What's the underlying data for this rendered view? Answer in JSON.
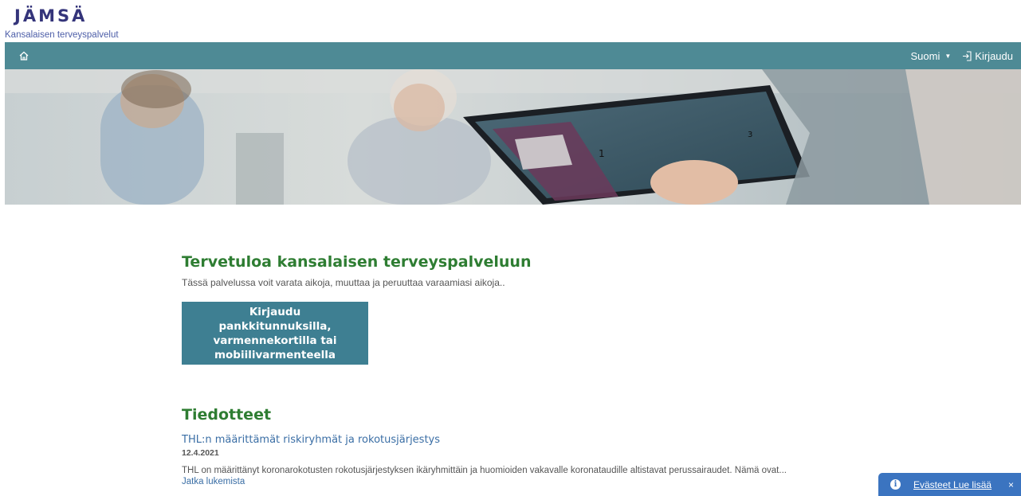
{
  "brand": {
    "logo_text": "JÄMSÄ",
    "subtitle": "Kansalaisen terveyspalvelut"
  },
  "navbar": {
    "home_icon": "home-icon",
    "language_label": "Suomi",
    "login_label": "Kirjaudu",
    "login_icon": "sign-in-icon",
    "background_color": "#4e8a95"
  },
  "main": {
    "welcome_title": "Tervetuloa kansalaisen terveyspalveluun",
    "welcome_text": "Tässä palvelussa voit varata aikoja, muuttaa ja peruuttaa varaamiasi aikoja..",
    "login_button_label": "Kirjaudu pankkitunnuksilla, varmennekortilla tai mobiilivarmenteella",
    "news_title": "Tiedotteet",
    "news": [
      {
        "title": "THL:n määrittämät riskiryhmät ja rokotusjärjestys",
        "date": "12.4.2021",
        "text": "THL on määrittänyt koronarokotusten rokotusjärjestyksen ikäryhmittäin ja huomioiden vakavalle koronataudille altistavat perussairaudet. Nämä ovat...",
        "read_more": "Jatka lukemista"
      }
    ]
  },
  "cookie": {
    "text": "Evästeet Lue lisää",
    "close": "×",
    "icon": "info-icon"
  },
  "colors": {
    "accent_green": "#2e7d32",
    "button_blue": "#3e7f92",
    "link_blue": "#3a6ea5",
    "cookie_blue": "#3b74c0"
  }
}
